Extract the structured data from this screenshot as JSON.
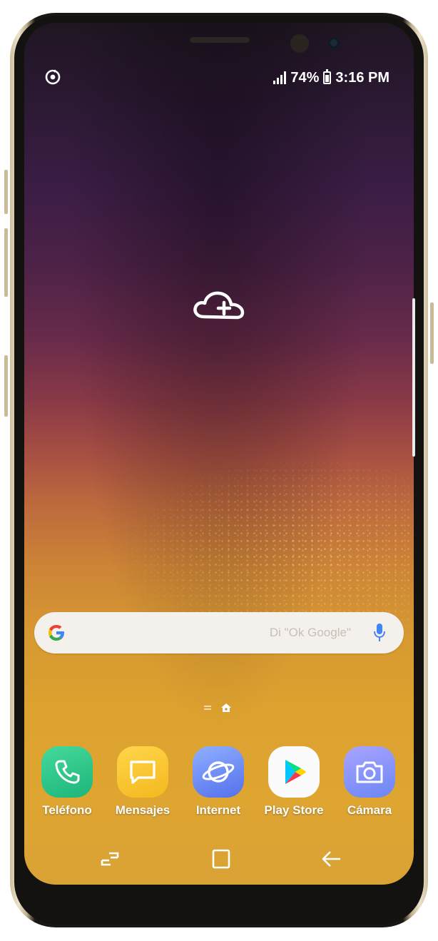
{
  "status_bar": {
    "battery_percent": "74%",
    "time": "3:16 PM",
    "left_icon": "sync-icon",
    "signal_icon": "signal-bars-icon",
    "battery_icon": "battery-icon"
  },
  "center_widget": {
    "icon": "cloud-add-icon"
  },
  "search_bar": {
    "logo": "google-g-icon",
    "placeholder": "Di \"Ok Google\"",
    "mic_icon": "microphone-icon"
  },
  "page_indicator": {
    "icons": [
      "menu-lines-icon",
      "home-page-icon"
    ]
  },
  "dock": {
    "apps": [
      {
        "label": "Teléfono",
        "icon": "phone-icon",
        "color": "#2fc98a"
      },
      {
        "label": "Mensajes",
        "icon": "messages-icon",
        "color": "#f7c531"
      },
      {
        "label": "Internet",
        "icon": "internet-browser-icon",
        "color": "#5f7ef4"
      },
      {
        "label": "Play Store",
        "icon": "play-store-icon",
        "color": "#ffffff"
      },
      {
        "label": "Cámara",
        "icon": "camera-icon",
        "color": "#7e8cf5"
      }
    ]
  },
  "nav_bar": {
    "recents": "recents-icon",
    "home": "home-button-icon",
    "back": "back-arrow-icon"
  },
  "colors": {
    "wallpaper_top": "#2b1933",
    "wallpaper_middle": "#a74f43",
    "wallpaper_bottom": "#dea531",
    "phone_frame": "#cdbf9e"
  }
}
